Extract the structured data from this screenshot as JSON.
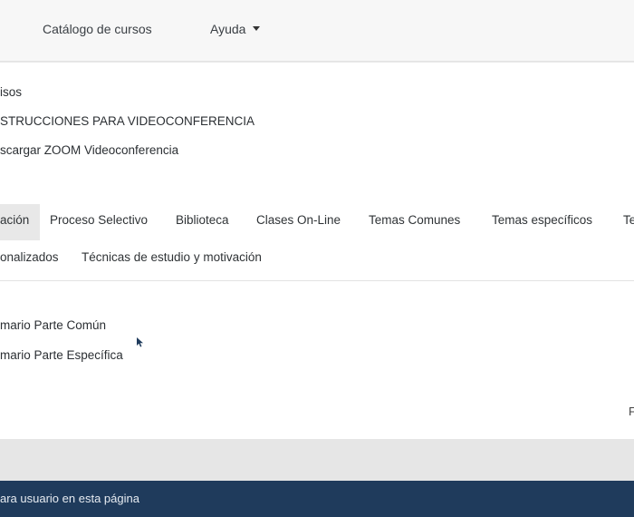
{
  "topnav": {
    "catalog_label": "Catálogo de cursos",
    "help_label": "Ayuda"
  },
  "links": [
    "isos",
    "STRUCCIONES PARA VIDEOCONFERENCIA",
    "scargar ZOOM Videoconferencia"
  ],
  "tabs": [
    "ación",
    "Proceso Selectivo",
    "Biblioteca",
    "Clases On-Line",
    "Temas Comunes",
    "Temas específicos",
    "Te",
    "onalizados",
    "Técnicas de estudio y motivación"
  ],
  "content": [
    "mario Parte Común",
    "mario Parte Específica"
  ],
  "page_edge_text": "F",
  "footer": {
    "text": "ara usuario en esta página"
  },
  "colors": {
    "footer_bg": "#1f3b5c",
    "active_tab_bg": "#e8e8e8"
  }
}
